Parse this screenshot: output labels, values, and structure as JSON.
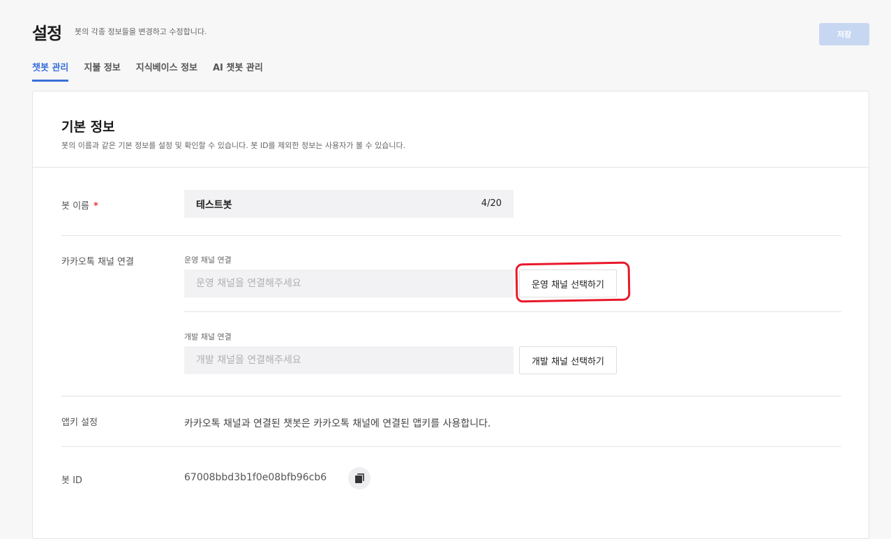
{
  "header": {
    "title": "설정",
    "description": "봇의 각종 정보들을 변경하고 수정합니다.",
    "save_label": "저장"
  },
  "tabs": [
    {
      "label": "챗봇 관리",
      "active": true
    },
    {
      "label": "지불 정보",
      "active": false
    },
    {
      "label": "지식베이스 정보",
      "active": false
    },
    {
      "label": "AI 챗봇 관리",
      "active": false
    }
  ],
  "basic_info": {
    "title": "기본 정보",
    "description": "봇의 이름과 같은 기본 정보를 설정 및 확인할 수 있습니다. 봇 ID를 제외한 정보는 사용자가 볼 수 있습니다.",
    "bot_name": {
      "label": "봇 이름",
      "required_mark": "*",
      "value": "테스트봇",
      "count": "4/20"
    },
    "kakao": {
      "label": "카카오톡 채널 연결",
      "operation": {
        "label": "운영 채널 연결",
        "placeholder": "운영 채널을 연결해주세요",
        "button": "운영 채널 선택하기"
      },
      "development": {
        "label": "개발 채널 연결",
        "placeholder": "개발 채널을 연결해주세요",
        "button": "개발 채널 선택하기"
      }
    },
    "appkey": {
      "label": "앱키 설정",
      "text": "카카오톡 채널과 연결된 챗봇은 카카오톡 채널에 연결된 앱키를 사용합니다."
    },
    "bot_id": {
      "label": "봇 ID",
      "value": "67008bbd3b1f0e08bfb96cb6"
    }
  },
  "colors": {
    "accent": "#3b6fd8",
    "save_disabled": "#c8d7f1",
    "required": "#e53935",
    "highlight": "#e8182a"
  }
}
